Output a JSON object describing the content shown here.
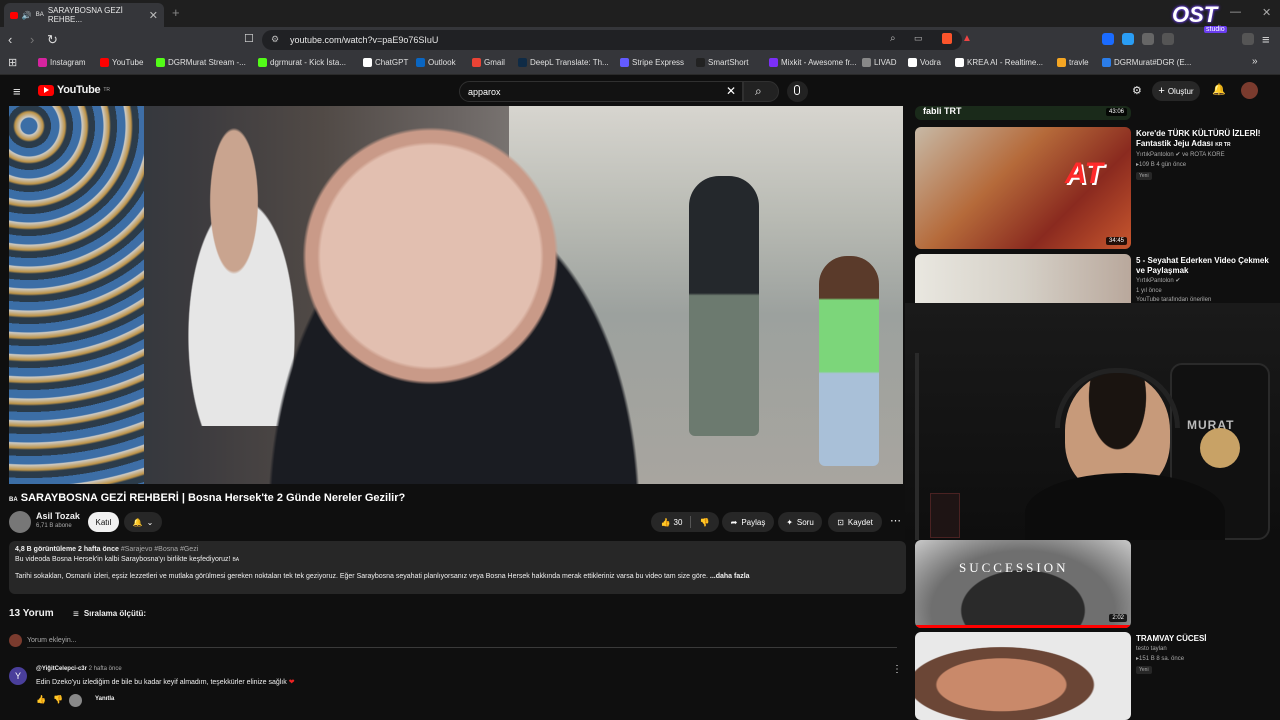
{
  "browser": {
    "tab_title": "SARAYBOSNA GEZİ REHBE...",
    "tab_flag": "BA",
    "url": "youtube.com/watch?v=paE9o76SIuU",
    "bookmarks": [
      {
        "label": "Instagram",
        "color": "#d6249f"
      },
      {
        "label": "YouTube",
        "color": "#ff0000"
      },
      {
        "label": "DGRMurat Stream -...",
        "color": "#53fc18"
      },
      {
        "label": "dgrmurat - Kick İsta...",
        "color": "#53fc18"
      },
      {
        "label": "ChatGPT",
        "color": "#ffffff"
      },
      {
        "label": "Outlook",
        "color": "#0a66c2"
      },
      {
        "label": "Gmail",
        "color": "#ea4335"
      },
      {
        "label": "DeepL Translate: Th...",
        "color": "#0f2b46"
      },
      {
        "label": "Stripe Express",
        "color": "#635bff"
      },
      {
        "label": "SmartShort",
        "color": "#222222"
      },
      {
        "label": "Mixkit - Awesome fr...",
        "color": "#7b2ff7"
      },
      {
        "label": "LIVAD",
        "color": "#888888"
      },
      {
        "label": "Vodra",
        "color": "#ffffff"
      },
      {
        "label": "KREA AI - Realtime...",
        "color": "#ffffff"
      },
      {
        "label": "travle",
        "color": "#f5a623"
      },
      {
        "label": "DGRMurat#DGR (E...",
        "color": "#2b7de9"
      }
    ]
  },
  "youtube": {
    "logo": "YouTube",
    "logo_suffix": "TR",
    "search_value": "apparox",
    "create_label": "Oluştur"
  },
  "video": {
    "flag": "BA",
    "title": "SARAYBOSNA GEZİ REHBERİ | Bosna Hersek'te 2 Günde Nereler Gezilir?",
    "channel": "Asil Tozak",
    "subscribers": "6,71 B abone",
    "join_label": "Katıl",
    "likes": "30",
    "share_label": "Paylaş",
    "ask_label": "Soru",
    "save_label": "Kaydet"
  },
  "description": {
    "stats": "4,8 B görüntüleme  2 hafta önce",
    "tags": "#Sarajevo #Bosna #Gezi",
    "line1": "Bu videoda Bosna Hersek'in kalbi Saraybosna'yı birlikte keşfediyoruz!",
    "line1_flag": "BA",
    "line2": "Tarihi sokakları, Osmanlı izleri, eşsiz lezzetleri ve mutlaka görülmesi gereken noktaları tek tek geziyoruz. Eğer Saraybosna seyahati planlıyorsanız veya Bosna Hersek hakkında merak ettikleriniz varsa bu video tam size göre.",
    "more": "...daha fazla"
  },
  "comments": {
    "count_label": "13 Yorum",
    "sort_label": "Sıralama ölçütü:",
    "add_placeholder": "Yorum ekleyin...",
    "items": [
      {
        "avatar_letter": "Y",
        "author": "@YiğitCelepci-c3r",
        "time": "2 hafta önce",
        "text": "Edin Dzeko'yu izlediğim de bile bu kadar keyif almadım, teşekkürler elinize sağlık",
        "reply_label": "Yanıtla"
      }
    ]
  },
  "sidebar": {
    "items": [
      {
        "title": "Kore'de TÜRK KÜLTÜRÜ İZLERİ! Fantastik Jeju Adası",
        "flag": "KR TR",
        "channel": "YırtıkPantolon",
        "collab": "ve ROTA KORE",
        "meta": "109 B  4 gün önce",
        "tag": "Yeni",
        "duration": "34:45"
      },
      {
        "title": "5 - Seyahat Ederken Video Çekmek ve Paylaşmak",
        "channel": "YırtıkPantolon",
        "meta": "1 yıl önce",
        "meta2": "YouTube tarafından önerilen",
        "duration": ""
      },
      {
        "title": "TRAMVAY CÜCESİ",
        "channel": "testo taylan",
        "meta": "151 B  8 sa. önce",
        "tag": "Yeni",
        "duration": "2:02",
        "thumb_text": "SUCCESSION"
      }
    ],
    "top_duration": "43:06",
    "top_thumb_text": "fabli TRT"
  },
  "overlay": {
    "brand": "OST",
    "brand_sub": "studio",
    "chair_text": "MURAT"
  }
}
